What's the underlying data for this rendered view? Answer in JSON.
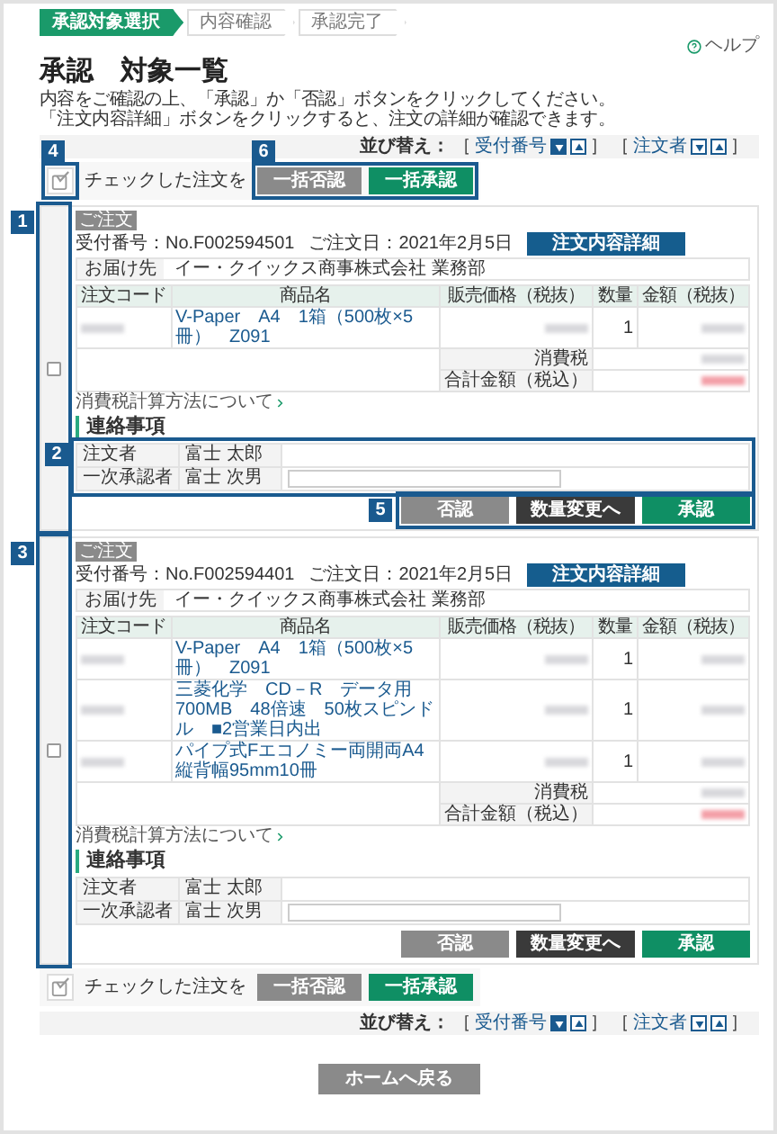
{
  "steps": [
    {
      "label": "承認対象選択",
      "selected": true
    },
    {
      "label": "内容確認",
      "selected": false
    },
    {
      "label": "承認完了",
      "selected": false
    }
  ],
  "help": "ヘルプ",
  "title": "承認　対象一覧",
  "instructions": [
    "内容をご確認の上、「承認」か「否認」ボタンをクリックしてください。",
    "「注文内容詳細」ボタンをクリックすると、注文の詳細が確認できます。"
  ],
  "sort_bar": {
    "label": "並び替え：",
    "keys": [
      {
        "open": "［",
        "label": "受付番号",
        "arrows": [
          {
            "kind": "down",
            "selected": true
          },
          {
            "kind": "up",
            "selected": false
          }
        ],
        "close": "］"
      },
      {
        "open": "［",
        "label": "注文者",
        "arrows": [
          {
            "kind": "down",
            "selected": false
          },
          {
            "kind": "up",
            "selected": false
          }
        ],
        "close": "］"
      }
    ]
  },
  "bulk_top": {
    "select_all_callout": "4",
    "buttons_callout": "6",
    "label": "チェックした注文を",
    "reject": "一括否認",
    "approve": "一括承認"
  },
  "orders": [
    {
      "checked": false,
      "checkbox_callout": "1",
      "tag": "ご注文",
      "number": "受付番号：No.F002594501",
      "date": "ご注文日：2021年2月5日",
      "detail_button": "注文内容詳細",
      "ship_label": "お届け先",
      "ship_to": "イー・クイックス商事株式会社 業務部",
      "columns": [
        "注文コード",
        "商品名",
        "販売価格（税抜）",
        "数量",
        "金額（税抜）"
      ],
      "items": [
        {
          "name": "V-Paper　A4　1箱（500枚×5冊）　Z091",
          "qty": "1"
        }
      ],
      "tax_label": "消費税",
      "total_label": "合計金額（税込）",
      "tax_link": "消費税計算方法について",
      "contact_heading": "連絡事項",
      "contact_callout": "2",
      "contacts": [
        {
          "role": "注文者",
          "name": "富士 太郎",
          "has_field": false
        },
        {
          "role": "一次承認者",
          "name": "富士 次男",
          "has_field": true
        }
      ],
      "actions_callout": "5",
      "reject": "否認",
      "change_qty": "数量変更へ",
      "approve": "承認"
    },
    {
      "checked": false,
      "checkbox_callout": "3",
      "tag": "ご注文",
      "number": "受付番号：No.F002594401",
      "date": "ご注文日：2021年2月5日",
      "detail_button": "注文内容詳細",
      "ship_label": "お届け先",
      "ship_to": "イー・クイックス商事株式会社 業務部",
      "columns": [
        "注文コード",
        "商品名",
        "販売価格（税抜）",
        "数量",
        "金額（税抜）"
      ],
      "items": [
        {
          "name": "V-Paper　A4　1箱（500枚×5冊）　Z091",
          "qty": "1"
        },
        {
          "name": "三菱化学　CD－R　データ用　700MB　48倍速　50枚スピンドル　■2営業日内出",
          "qty": "1"
        },
        {
          "name": "パイプ式Fエコノミー両開両A4縦背幅95mm10冊",
          "qty": "1"
        }
      ],
      "tax_label": "消費税",
      "total_label": "合計金額（税込）",
      "tax_link": "消費税計算方法について",
      "contact_heading": "連絡事項",
      "contacts": [
        {
          "role": "注文者",
          "name": "富士 太郎",
          "has_field": false
        },
        {
          "role": "一次承認者",
          "name": "富士 次男",
          "has_field": true
        }
      ],
      "reject": "否認",
      "change_qty": "数量変更へ",
      "approve": "承認"
    }
  ],
  "bulk_bottom": {
    "label": "チェックした注文を",
    "reject": "一括否認",
    "approve": "一括承認"
  },
  "sort_bar_bottom": {
    "label": "並び替え：",
    "keys": [
      {
        "open": "［",
        "label": "受付番号",
        "arrows": [
          {
            "kind": "down",
            "selected": true
          },
          {
            "kind": "up",
            "selected": false
          }
        ],
        "close": "］"
      },
      {
        "open": "［",
        "label": "注文者",
        "arrows": [
          {
            "kind": "down",
            "selected": false
          },
          {
            "kind": "up",
            "selected": false
          }
        ],
        "close": "］"
      }
    ]
  },
  "home_button": "ホームへ戻る"
}
